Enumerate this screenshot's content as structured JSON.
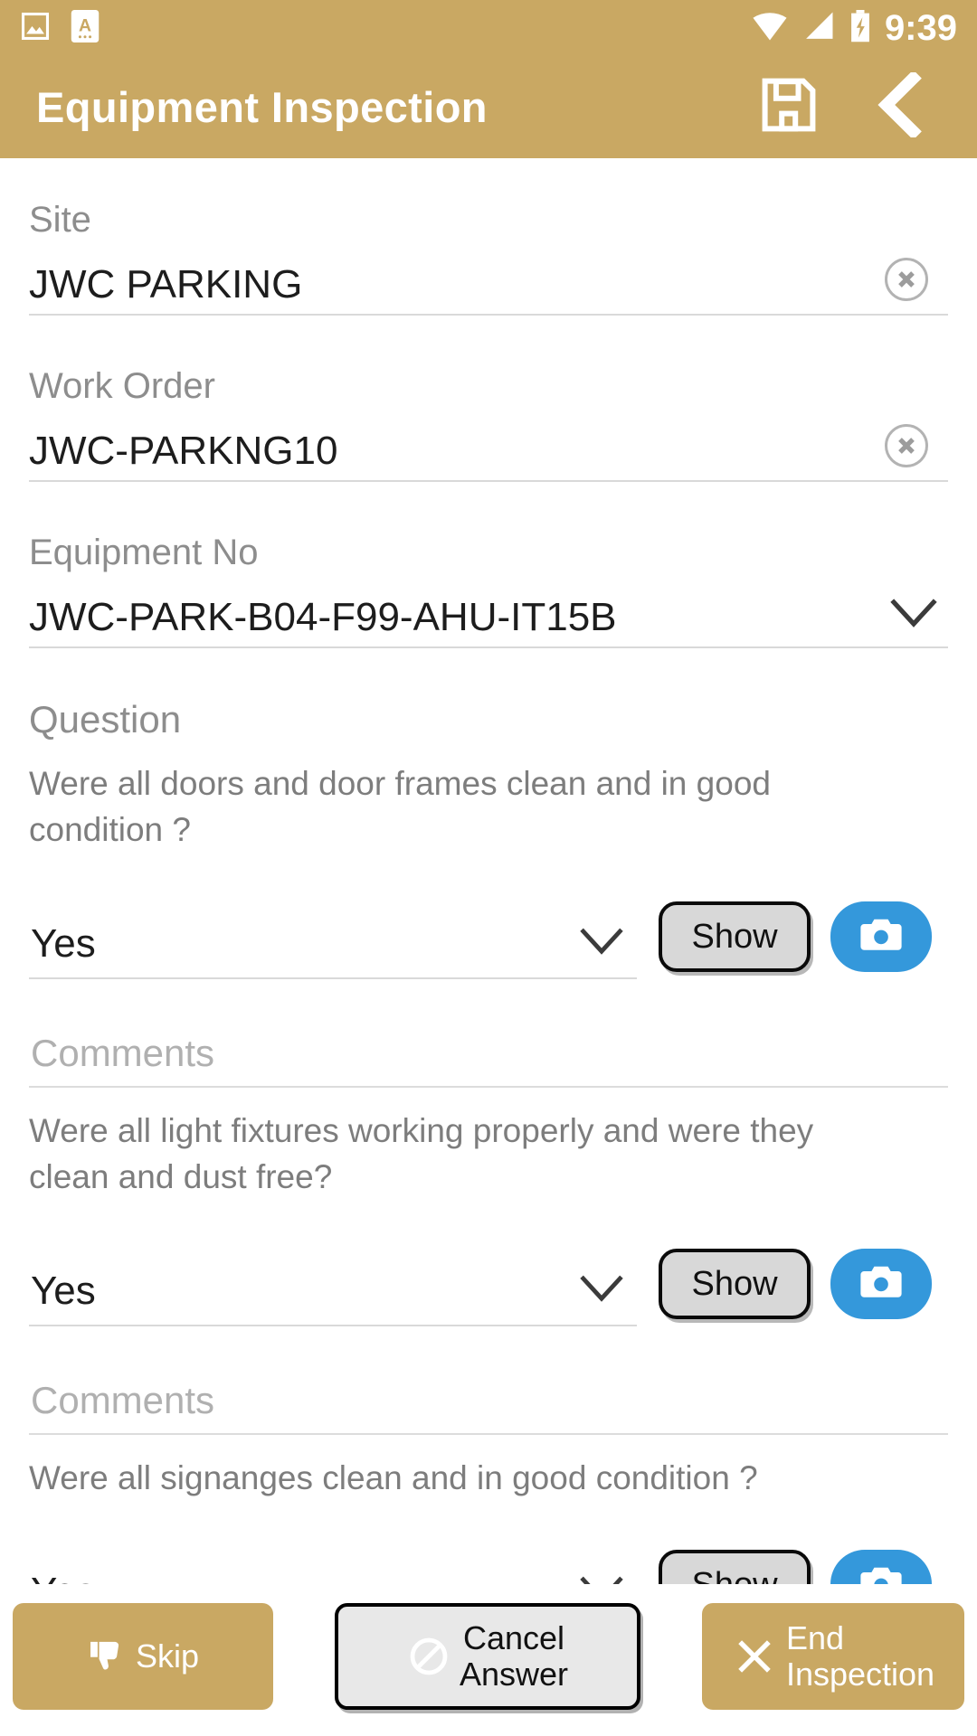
{
  "status_bar": {
    "time": "9:39",
    "icons": [
      "image-icon",
      "app-a-icon",
      "wifi-icon",
      "cellular-signal-icon",
      "battery-charging-icon"
    ]
  },
  "app_bar": {
    "title": "Equipment Inspection",
    "save_icon": "floppy-disk-save-icon",
    "back_icon": "back-chevron-icon"
  },
  "theme": {
    "accent_tan": "#c9a863",
    "camera_blue": "#3498db",
    "label_gray": "#8d8d8d",
    "value_black": "#1d1d1d",
    "placeholder_gray": "#b0b0b0"
  },
  "form": {
    "site": {
      "label": "Site",
      "value": "JWC PARKING",
      "clear_icon": "clear-circle-icon"
    },
    "work_order": {
      "label": "Work Order",
      "value": "JWC-PARKNG10",
      "clear_icon": "clear-circle-icon"
    },
    "equipment_no": {
      "label": "Equipment No",
      "value": "JWC-PARK-B04-F99-AHU-IT15B",
      "chevron_icon": "chevron-down-icon"
    }
  },
  "question_section": {
    "heading": "Question",
    "show_label": "Show",
    "camera_icon": "camera-icon",
    "chevron_icon": "chevron-down-icon",
    "comments_placeholder": "Comments",
    "items": [
      {
        "text": "Were all doors and door frames clean and in good condition ?",
        "answer": "Yes",
        "comment": ""
      },
      {
        "text": "Were all light fixtures working properly and were they clean and dust free?",
        "answer": "Yes",
        "comment": ""
      },
      {
        "text": "Were all signanges clean and in good condition ?",
        "answer": "Yes",
        "comment": ""
      }
    ]
  },
  "bottom_bar": {
    "skip": {
      "label": "Skip",
      "icon": "thumbs-down-icon"
    },
    "cancel_answer": {
      "label_line1": "Cancel",
      "label_line2": "Answer",
      "icon": "prohibition-icon"
    },
    "end_inspection": {
      "label_line1": "End",
      "label_line2": "Inspection",
      "icon": "close-x-icon"
    }
  }
}
